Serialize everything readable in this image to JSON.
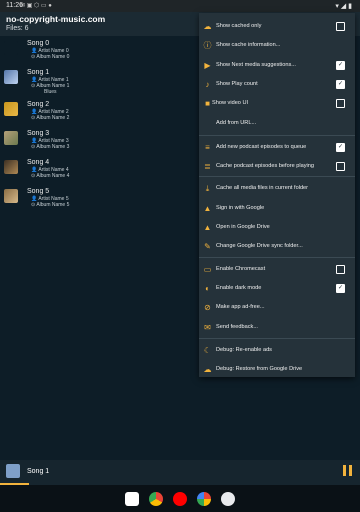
{
  "statusbar": {
    "time": "11:26",
    "status_icons": "✉ ▣ ⬡ ▭ ●"
  },
  "appbar": {
    "title": "no-copyright-music.com",
    "files": "Files: 6"
  },
  "songs": [
    {
      "title": "Song 0",
      "artist": "Artist Name 0",
      "album": "Album Name 0"
    },
    {
      "title": "Song 1",
      "artist": "Artist Name 1",
      "album": "Album Name 1",
      "genre": "Blues"
    },
    {
      "title": "Song 2",
      "artist": "Artist Name 2",
      "album": "Album Name 2"
    },
    {
      "title": "Song 3",
      "artist": "Artist Name 3",
      "album": "Album Name 3"
    },
    {
      "title": "Song 4",
      "artist": "Artist Name 4",
      "album": "Album Name 4"
    },
    {
      "title": "Song 5",
      "artist": "Artist Name 5",
      "album": "Album Name 5"
    }
  ],
  "menu": [
    {
      "label": "Show cached only",
      "icon": "cloud-off-icon",
      "checkbox": "unchecked"
    },
    {
      "label": "Show cache information...",
      "icon": "info-icon"
    },
    {
      "label": "Show Next media suggestions...",
      "icon": "next-media-icon",
      "checkbox": "checked"
    },
    {
      "label": "Show Play count",
      "icon": "music-note-icon",
      "checkbox": "checked"
    },
    {
      "label": "Show video UI",
      "icon": "video-icon",
      "checkbox": "unchecked"
    },
    {
      "label": "Add from URL...",
      "icon": "link-icon"
    },
    {
      "label": "Add new podcast episodes to queue",
      "icon": "playlist-add-icon",
      "checkbox": "checked"
    },
    {
      "label": "Cache podcast episodes before playing",
      "icon": "cache-podcast-icon",
      "checkbox": "unchecked"
    },
    {
      "label": "Cache all media files in current folder",
      "icon": "download-icon"
    },
    {
      "label": "Sign in with Google",
      "icon": "google-drive-icon"
    },
    {
      "label": "Open in Google Drive",
      "icon": "google-drive-icon"
    },
    {
      "label": "Change Google Drive sync folder...",
      "icon": "edit-icon"
    },
    {
      "label": "Enable Chromecast",
      "icon": "cast-icon",
      "checkbox": "unchecked"
    },
    {
      "label": "Enable dark mode",
      "icon": "dark-mode-icon",
      "checkbox": "checked"
    },
    {
      "label": "Make app ad-free...",
      "icon": "ad-free-icon"
    },
    {
      "label": "Send feedback...",
      "icon": "mail-icon"
    },
    {
      "label": "Debug: Re-enable ads",
      "icon": "moon-icon"
    },
    {
      "label": "Debug: Restore from Google Drive",
      "icon": "cloud-download-icon"
    }
  ],
  "nowplaying": {
    "title": "Song 1",
    "progress": 0.08
  },
  "colors": {
    "accent": "#f2b33d",
    "background": "#0d1d27",
    "menu": "#25323a"
  },
  "dock": [
    "gmail-icon",
    "chrome-icon",
    "youtube-icon",
    "photos-icon",
    "apps-icon"
  ]
}
